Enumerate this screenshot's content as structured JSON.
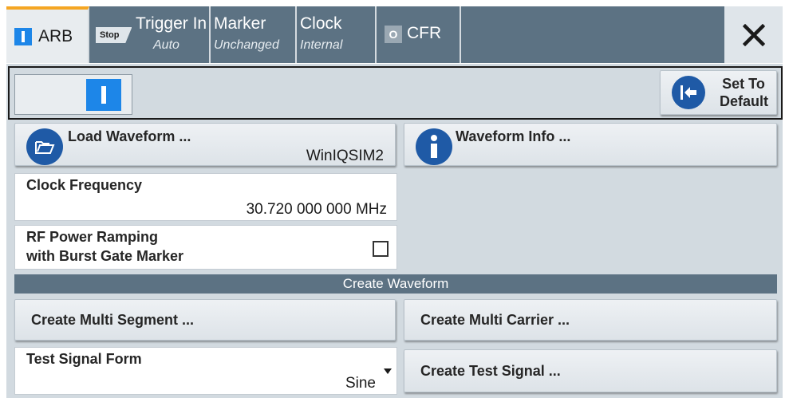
{
  "tabs": [
    {
      "label": "ARB",
      "sub": "",
      "state": "on",
      "active": true
    },
    {
      "label": "Trigger In",
      "sub": "Auto",
      "indicator": "Stop"
    },
    {
      "label": "Marker",
      "sub": "Unchanged"
    },
    {
      "label": "Clock",
      "sub": "Internal"
    },
    {
      "label": "CFR",
      "sub": "",
      "state": "off",
      "indicator": "O"
    }
  ],
  "close_icon": "close-icon",
  "state_switch": {
    "value": "on"
  },
  "set_default": {
    "line1": "Set To",
    "line2": "Default"
  },
  "load_waveform": {
    "label": "Load Waveform ...",
    "value": "WinIQSIM2"
  },
  "waveform_info": {
    "label": "Waveform Info ..."
  },
  "clock_frequency": {
    "label": "Clock Frequency",
    "value": "30.720 000 000 MHz"
  },
  "rf_power_ramping": {
    "line1": "RF Power Ramping",
    "line2": "with Burst Gate Marker",
    "checked": false
  },
  "create_waveform": {
    "title": "Create Waveform"
  },
  "create_multi_segment": {
    "label": "Create Multi Segment ..."
  },
  "create_multi_carrier": {
    "label": "Create Multi Carrier ..."
  },
  "test_signal_form": {
    "label": "Test Signal Form",
    "value": "Sine"
  },
  "create_test_signal": {
    "label": "Create Test Signal ..."
  },
  "colors": {
    "accent": "#1d86e8",
    "tab_bg": "#5c7283",
    "active_tab_marker": "#f5a623",
    "icon_blue": "#1f5aa6"
  }
}
